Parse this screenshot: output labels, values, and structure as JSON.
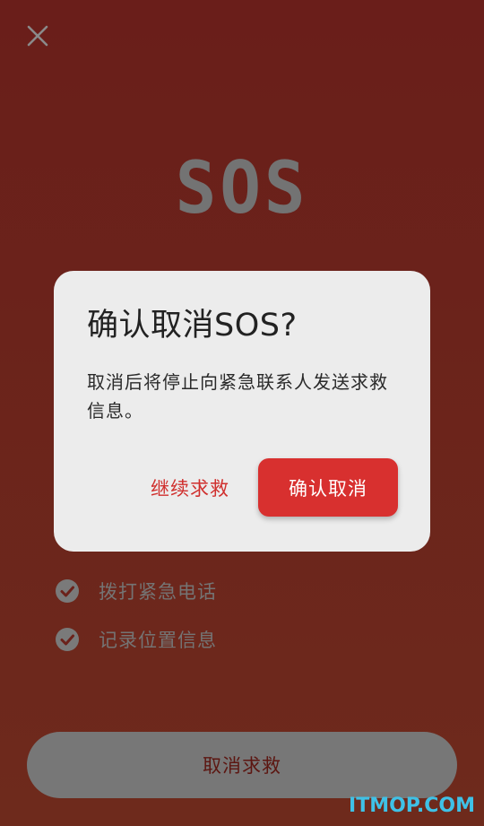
{
  "header": {
    "close_icon": "close-icon"
  },
  "hero": {
    "title": "SOS"
  },
  "checklist": {
    "items": [
      {
        "label": "拨打紧急电话",
        "icon": "check-circle-icon"
      },
      {
        "label": "记录位置信息",
        "icon": "check-circle-icon"
      }
    ]
  },
  "footer": {
    "cancel_rescue_label": "取消求救"
  },
  "dialog": {
    "title": "确认取消SOS?",
    "message": "取消后将停止向紧急联系人发送求救信息。",
    "continue_label": "继续求救",
    "confirm_label": "确认取消"
  },
  "watermark": {
    "text": "ITMOP.COM"
  },
  "colors": {
    "background": "#6b221b",
    "accent": "#d8302f",
    "dialog_bg": "#ececec",
    "muted": "#777777",
    "watermark": "#3fc1e6"
  }
}
